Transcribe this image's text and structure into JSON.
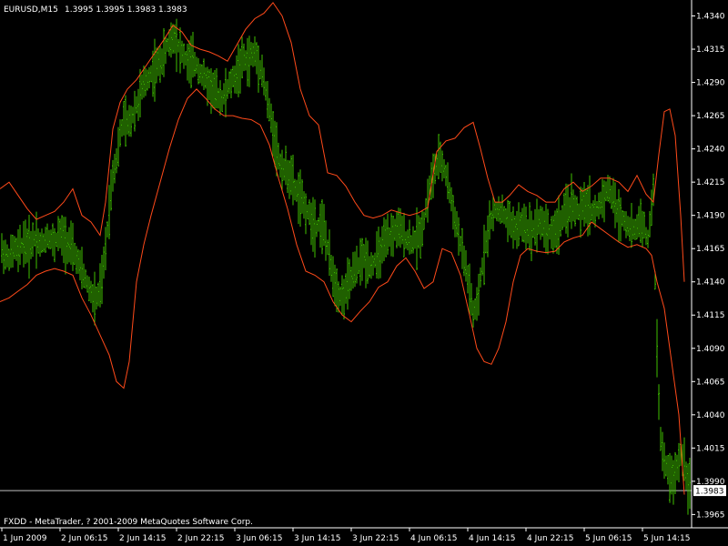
{
  "header": {
    "symbol": "EURUSD,M15",
    "ohlc": "1.3995 1.3995 1.3983 1.3983"
  },
  "footer": {
    "copyright": "FXDD - MetaTrader, ? 2001-2009 MetaQuotes Software Corp."
  },
  "colors": {
    "background": "#000000",
    "bars": "#3fbf00",
    "bollinger": "#ff4a1a",
    "axis": "#ffffff",
    "price_tag_bg": "#ffffff",
    "price_tag_text": "#000000"
  },
  "chart_data": {
    "type": "line",
    "ylim": [
      1.3955,
      1.4352
    ],
    "current_price": 1.3983,
    "y_ticks": [
      "1.4340",
      "1.4315",
      "1.4290",
      "1.4265",
      "1.4240",
      "1.4215",
      "1.4190",
      "1.4165",
      "1.4140",
      "1.4115",
      "1.4090",
      "1.4065",
      "1.4040",
      "1.4015",
      "1.3990",
      "1.3965"
    ],
    "x_ticks": [
      "1 Jun 2009",
      "2 Jun 06:15",
      "2 Jun 14:15",
      "2 Jun 22:15",
      "3 Jun 06:15",
      "3 Jun 14:15",
      "3 Jun 22:15",
      "4 Jun 06:15",
      "4 Jun 14:15",
      "4 Jun 22:15",
      "5 Jun 06:15",
      "5 Jun 14:15"
    ],
    "price_path": [
      [
        0,
        1.4165
      ],
      [
        4,
        1.4162
      ],
      [
        8,
        1.4158
      ],
      [
        12,
        1.416
      ],
      [
        16,
        1.4165
      ],
      [
        20,
        1.4162
      ],
      [
        24,
        1.4168
      ],
      [
        28,
        1.417
      ],
      [
        32,
        1.4166
      ],
      [
        36,
        1.4172
      ],
      [
        40,
        1.4174
      ],
      [
        44,
        1.4168
      ],
      [
        48,
        1.417
      ],
      [
        52,
        1.4175
      ],
      [
        56,
        1.4172
      ],
      [
        60,
        1.4168
      ],
      [
        64,
        1.4176
      ],
      [
        68,
        1.4174
      ],
      [
        72,
        1.417
      ],
      [
        76,
        1.4168
      ],
      [
        80,
        1.4163
      ],
      [
        84,
        1.4158
      ],
      [
        88,
        1.415
      ],
      [
        92,
        1.4145
      ],
      [
        96,
        1.4138
      ],
      [
        100,
        1.4132
      ],
      [
        104,
        1.4125
      ],
      [
        108,
        1.413
      ],
      [
        112,
        1.414
      ],
      [
        116,
        1.4165
      ],
      [
        120,
        1.4195
      ],
      [
        124,
        1.4222
      ],
      [
        128,
        1.4232
      ],
      [
        132,
        1.425
      ],
      [
        136,
        1.4262
      ],
      [
        140,
        1.4258
      ],
      [
        144,
        1.4262
      ],
      [
        148,
        1.427
      ],
      [
        152,
        1.4275
      ],
      [
        156,
        1.4285
      ],
      [
        160,
        1.429
      ],
      [
        164,
        1.4295
      ],
      [
        168,
        1.4298
      ],
      [
        172,
        1.4302
      ],
      [
        176,
        1.4305
      ],
      [
        180,
        1.431
      ],
      [
        184,
        1.4318
      ],
      [
        188,
        1.4322
      ],
      [
        192,
        1.4325
      ],
      [
        196,
        1.4318
      ],
      [
        200,
        1.4312
      ],
      [
        204,
        1.4308
      ],
      [
        208,
        1.4304
      ],
      [
        212,
        1.4306
      ],
      [
        216,
        1.4303
      ],
      [
        220,
        1.4298
      ],
      [
        224,
        1.4294
      ],
      [
        228,
        1.429
      ],
      [
        232,
        1.4286
      ],
      [
        236,
        1.4283
      ],
      [
        240,
        1.428
      ],
      [
        244,
        1.4278
      ],
      [
        248,
        1.4282
      ],
      [
        252,
        1.4288
      ],
      [
        256,
        1.4292
      ],
      [
        260,
        1.4296
      ],
      [
        264,
        1.4302
      ],
      [
        268,
        1.4308
      ],
      [
        272,
        1.4305
      ],
      [
        276,
        1.431
      ],
      [
        280,
        1.4312
      ],
      [
        284,
        1.4305
      ],
      [
        288,
        1.4298
      ],
      [
        292,
        1.4283
      ],
      [
        296,
        1.4268
      ],
      [
        300,
        1.4255
      ],
      [
        304,
        1.424
      ],
      [
        308,
        1.4228
      ],
      [
        312,
        1.4225
      ],
      [
        316,
        1.4222
      ],
      [
        320,
        1.4218
      ],
      [
        324,
        1.421
      ],
      [
        328,
        1.4205
      ],
      [
        332,
        1.42
      ],
      [
        336,
        1.4195
      ],
      [
        340,
        1.419
      ],
      [
        344,
        1.4185
      ],
      [
        348,
        1.4182
      ],
      [
        352,
        1.4185
      ],
      [
        356,
        1.418
      ],
      [
        360,
        1.4165
      ],
      [
        364,
        1.415
      ],
      [
        368,
        1.414
      ],
      [
        372,
        1.4132
      ],
      [
        376,
        1.4128
      ],
      [
        380,
        1.4133
      ],
      [
        384,
        1.414
      ],
      [
        388,
        1.4146
      ],
      [
        392,
        1.415
      ],
      [
        396,
        1.4155
      ],
      [
        400,
        1.4158
      ],
      [
        404,
        1.4155
      ],
      [
        408,
        1.4152
      ],
      [
        412,
        1.4156
      ],
      [
        416,
        1.416
      ],
      [
        420,
        1.4165
      ],
      [
        424,
        1.417
      ],
      [
        428,
        1.4174
      ],
      [
        432,
        1.4176
      ],
      [
        436,
        1.418
      ],
      [
        440,
        1.4178
      ],
      [
        444,
        1.4175
      ],
      [
        448,
        1.4172
      ],
      [
        452,
        1.417
      ],
      [
        456,
        1.4172
      ],
      [
        460,
        1.4175
      ],
      [
        464,
        1.418
      ],
      [
        468,
        1.4195
      ],
      [
        472,
        1.421
      ],
      [
        476,
        1.422
      ],
      [
        480,
        1.4228
      ],
      [
        484,
        1.4232
      ],
      [
        488,
        1.4225
      ],
      [
        492,
        1.4215
      ],
      [
        496,
        1.42
      ],
      [
        500,
        1.4188
      ],
      [
        504,
        1.4175
      ],
      [
        508,
        1.4162
      ],
      [
        512,
        1.415
      ],
      [
        516,
        1.4135
      ],
      [
        520,
        1.4115
      ],
      [
        524,
        1.412
      ],
      [
        528,
        1.4142
      ],
      [
        532,
        1.4162
      ],
      [
        536,
        1.4178
      ],
      [
        540,
        1.4188
      ],
      [
        544,
        1.4192
      ],
      [
        548,
        1.4195
      ],
      [
        552,
        1.4192
      ],
      [
        556,
        1.4188
      ],
      [
        560,
        1.4185
      ],
      [
        564,
        1.4182
      ],
      [
        568,
        1.418
      ],
      [
        572,
        1.4182
      ],
      [
        576,
        1.4184
      ],
      [
        580,
        1.418
      ],
      [
        584,
        1.4178
      ],
      [
        588,
        1.4182
      ],
      [
        592,
        1.4186
      ],
      [
        596,
        1.4183
      ],
      [
        600,
        1.418
      ],
      [
        604,
        1.4178
      ],
      [
        608,
        1.4177
      ],
      [
        612,
        1.418
      ],
      [
        616,
        1.4185
      ],
      [
        620,
        1.419
      ],
      [
        624,
        1.4195
      ],
      [
        628,
        1.4198
      ],
      [
        632,
        1.4196
      ],
      [
        636,
        1.4192
      ],
      [
        640,
        1.4195
      ],
      [
        644,
        1.4198
      ],
      [
        648,
        1.4196
      ],
      [
        652,
        1.4192
      ],
      [
        656,
        1.4194
      ],
      [
        660,
        1.42
      ],
      [
        664,
        1.4205
      ],
      [
        668,
        1.421
      ],
      [
        672,
        1.4205
      ],
      [
        676,
        1.4198
      ],
      [
        680,
        1.419
      ],
      [
        684,
        1.4188
      ],
      [
        688,
        1.4185
      ],
      [
        692,
        1.418
      ],
      [
        696,
        1.4178
      ],
      [
        700,
        1.4182
      ],
      [
        704,
        1.4186
      ],
      [
        708,
        1.418
      ],
      [
        712,
        1.417
      ],
      [
        716,
        1.4195
      ],
      [
        718,
        1.421
      ],
      [
        720,
        1.414
      ],
      [
        722,
        1.409
      ],
      [
        725,
        1.403
      ],
      [
        728,
        1.401
      ],
      [
        732,
        1.4
      ],
      [
        736,
        1.3995
      ],
      [
        740,
        1.399
      ],
      [
        744,
        1.4
      ],
      [
        748,
        1.401
      ],
      [
        752,
        1.4005
      ],
      [
        756,
        1.399
      ],
      [
        760,
        1.3983
      ]
    ],
    "bollinger_upper": [
      [
        0,
        1.421
      ],
      [
        10,
        1.4215
      ],
      [
        20,
        1.4205
      ],
      [
        30,
        1.4195
      ],
      [
        40,
        1.4187
      ],
      [
        50,
        1.419
      ],
      [
        60,
        1.4193
      ],
      [
        70,
        1.42
      ],
      [
        80,
        1.421
      ],
      [
        90,
        1.419
      ],
      [
        100,
        1.4185
      ],
      [
        110,
        1.4175
      ],
      [
        116,
        1.42
      ],
      [
        124,
        1.4255
      ],
      [
        132,
        1.4275
      ],
      [
        140,
        1.4285
      ],
      [
        150,
        1.4292
      ],
      [
        160,
        1.4302
      ],
      [
        170,
        1.4312
      ],
      [
        180,
        1.4322
      ],
      [
        190,
        1.4333
      ],
      [
        200,
        1.4328
      ],
      [
        210,
        1.4318
      ],
      [
        220,
        1.4315
      ],
      [
        230,
        1.4313
      ],
      [
        240,
        1.431
      ],
      [
        250,
        1.4306
      ],
      [
        260,
        1.4318
      ],
      [
        270,
        1.433
      ],
      [
        280,
        1.4338
      ],
      [
        290,
        1.4342
      ],
      [
        300,
        1.435
      ],
      [
        310,
        1.434
      ],
      [
        320,
        1.432
      ],
      [
        330,
        1.4285
      ],
      [
        340,
        1.4265
      ],
      [
        350,
        1.4258
      ],
      [
        360,
        1.4222
      ],
      [
        370,
        1.422
      ],
      [
        380,
        1.4212
      ],
      [
        390,
        1.42
      ],
      [
        400,
        1.419
      ],
      [
        410,
        1.4188
      ],
      [
        420,
        1.419
      ],
      [
        430,
        1.4194
      ],
      [
        440,
        1.4192
      ],
      [
        450,
        1.419
      ],
      [
        460,
        1.4192
      ],
      [
        470,
        1.4196
      ],
      [
        480,
        1.4238
      ],
      [
        490,
        1.4246
      ],
      [
        500,
        1.4248
      ],
      [
        510,
        1.4256
      ],
      [
        520,
        1.426
      ],
      [
        528,
        1.424
      ],
      [
        536,
        1.4218
      ],
      [
        544,
        1.42
      ],
      [
        552,
        1.42
      ],
      [
        560,
        1.4205
      ],
      [
        570,
        1.4213
      ],
      [
        580,
        1.4208
      ],
      [
        590,
        1.4205
      ],
      [
        600,
        1.42
      ],
      [
        610,
        1.42
      ],
      [
        620,
        1.421
      ],
      [
        630,
        1.4215
      ],
      [
        640,
        1.4208
      ],
      [
        650,
        1.4212
      ],
      [
        660,
        1.4218
      ],
      [
        670,
        1.4218
      ],
      [
        680,
        1.4215
      ],
      [
        690,
        1.4208
      ],
      [
        700,
        1.422
      ],
      [
        710,
        1.4206
      ],
      [
        718,
        1.42
      ],
      [
        724,
        1.4236
      ],
      [
        730,
        1.4268
      ],
      [
        736,
        1.427
      ],
      [
        742,
        1.425
      ],
      [
        748,
        1.419
      ],
      [
        752,
        1.414
      ]
    ],
    "bollinger_lower": [
      [
        0,
        1.4125
      ],
      [
        10,
        1.4128
      ],
      [
        20,
        1.4133
      ],
      [
        30,
        1.4138
      ],
      [
        40,
        1.4145
      ],
      [
        50,
        1.4148
      ],
      [
        60,
        1.415
      ],
      [
        70,
        1.4148
      ],
      [
        80,
        1.4145
      ],
      [
        90,
        1.4128
      ],
      [
        100,
        1.4115
      ],
      [
        110,
        1.41
      ],
      [
        120,
        1.4085
      ],
      [
        128,
        1.4065
      ],
      [
        136,
        1.406
      ],
      [
        142,
        1.408
      ],
      [
        150,
        1.414
      ],
      [
        158,
        1.4168
      ],
      [
        166,
        1.419
      ],
      [
        176,
        1.4215
      ],
      [
        186,
        1.424
      ],
      [
        196,
        1.4262
      ],
      [
        206,
        1.4278
      ],
      [
        216,
        1.4285
      ],
      [
        226,
        1.4278
      ],
      [
        236,
        1.427
      ],
      [
        246,
        1.4265
      ],
      [
        256,
        1.4265
      ],
      [
        266,
        1.4263
      ],
      [
        276,
        1.4262
      ],
      [
        286,
        1.4258
      ],
      [
        296,
        1.4243
      ],
      [
        306,
        1.4218
      ],
      [
        316,
        1.4195
      ],
      [
        326,
        1.4168
      ],
      [
        336,
        1.4148
      ],
      [
        346,
        1.4145
      ],
      [
        356,
        1.414
      ],
      [
        366,
        1.4125
      ],
      [
        376,
        1.4115
      ],
      [
        386,
        1.411
      ],
      [
        396,
        1.4118
      ],
      [
        406,
        1.4125
      ],
      [
        416,
        1.4136
      ],
      [
        426,
        1.414
      ],
      [
        436,
        1.4152
      ],
      [
        446,
        1.4158
      ],
      [
        456,
        1.4148
      ],
      [
        466,
        1.4135
      ],
      [
        476,
        1.414
      ],
      [
        486,
        1.4165
      ],
      [
        496,
        1.4162
      ],
      [
        506,
        1.4145
      ],
      [
        516,
        1.4115
      ],
      [
        524,
        1.409
      ],
      [
        532,
        1.408
      ],
      [
        540,
        1.4078
      ],
      [
        548,
        1.409
      ],
      [
        556,
        1.411
      ],
      [
        564,
        1.414
      ],
      [
        572,
        1.416
      ],
      [
        580,
        1.4165
      ],
      [
        590,
        1.4163
      ],
      [
        600,
        1.4162
      ],
      [
        610,
        1.4163
      ],
      [
        620,
        1.417
      ],
      [
        630,
        1.4173
      ],
      [
        640,
        1.4175
      ],
      [
        650,
        1.4185
      ],
      [
        660,
        1.418
      ],
      [
        670,
        1.4175
      ],
      [
        680,
        1.417
      ],
      [
        690,
        1.4166
      ],
      [
        700,
        1.4168
      ],
      [
        710,
        1.4165
      ],
      [
        716,
        1.416
      ],
      [
        722,
        1.414
      ],
      [
        730,
        1.412
      ],
      [
        738,
        1.408
      ],
      [
        746,
        1.404
      ],
      [
        752,
        1.398
      ]
    ]
  }
}
